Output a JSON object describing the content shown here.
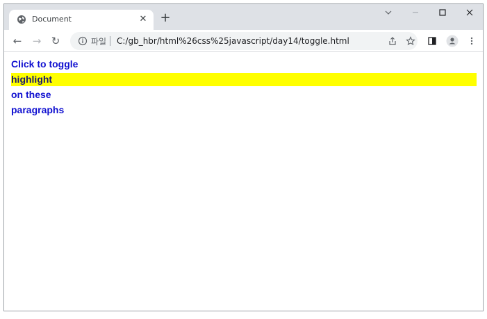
{
  "tab": {
    "title": "Document",
    "close_glyph": "✕",
    "favicon": "globe-icon"
  },
  "newtab": {
    "glyph": "+"
  },
  "window_controls": {
    "dropdown": "⌄",
    "minimize": "—",
    "close": "✕"
  },
  "toolbar": {
    "back": "←",
    "forward": "→",
    "reload": "↻",
    "security_label": "파일",
    "url": "C:/gb_hbr/html%26css%25javascript/day14/toggle.html"
  },
  "page": {
    "paragraphs": [
      {
        "text": "Click to toggle",
        "highlighted": false
      },
      {
        "text": "highlight",
        "highlighted": true
      },
      {
        "text": "on these",
        "highlighted": false
      },
      {
        "text": "paragraphs",
        "highlighted": false
      }
    ],
    "colors": {
      "text": "#1010d0",
      "highlight": "#ffff00"
    }
  }
}
